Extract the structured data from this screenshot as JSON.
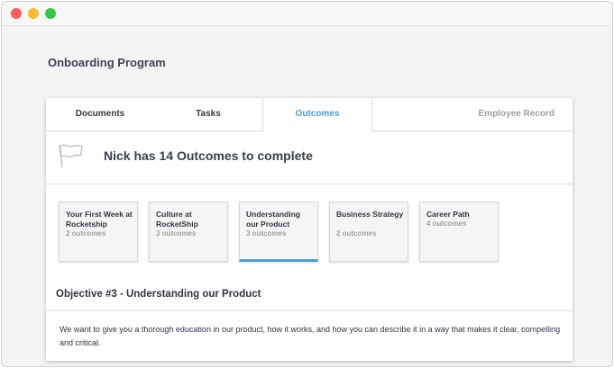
{
  "page": {
    "title": "Onboarding Program"
  },
  "tabs": [
    {
      "label": "Documents"
    },
    {
      "label": "Tasks"
    },
    {
      "label": "Outcomes"
    },
    {
      "label": "Employee Record"
    }
  ],
  "active_tab": "Outcomes",
  "headline": "Nick has 14 Outcomes to complete",
  "outcome_cards": [
    {
      "title": "Your First Week at Rocketship",
      "count": "2 outcomes"
    },
    {
      "title": "Culture at RocketShip",
      "count": "3 outcomes"
    },
    {
      "title": "Understanding our Product",
      "count": "3 outcomes"
    },
    {
      "title": "Business Strategy",
      "count": "2 outcomes"
    },
    {
      "title": "Career Path",
      "count": "4 outcomes"
    }
  ],
  "objective": {
    "title": "Objective #3 - Understanding our Product",
    "description": "We want to give you a thorough education in our product, how it works, and how you can describe it in a way that makes it clear, compelling and critical."
  },
  "colors": {
    "accent": "#4a9fd5",
    "close": "#fc5f57",
    "minimize": "#fdbc2e",
    "zoom": "#35c748"
  },
  "icons": {
    "headline": "flag-icon"
  }
}
